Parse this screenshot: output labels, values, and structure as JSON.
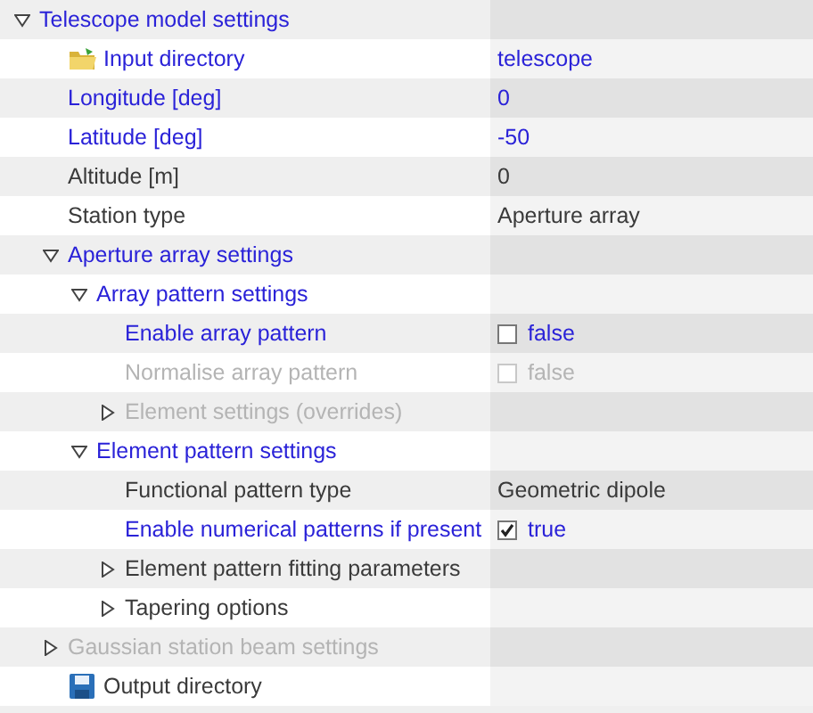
{
  "tree": [
    {
      "label": "Telescope model settings",
      "modified": true,
      "disabled": false,
      "expanded": true,
      "children": [
        {
          "label": "Input directory",
          "kind": "folder",
          "value": "telescope",
          "modified": true,
          "disabled": false
        },
        {
          "label": "Longitude [deg]",
          "value": "0",
          "modified": true,
          "disabled": false
        },
        {
          "label": "Latitude [deg]",
          "value": "-50",
          "modified": true,
          "disabled": false
        },
        {
          "label": "Altitude [m]",
          "value": "0",
          "modified": false,
          "disabled": false
        },
        {
          "label": "Station type",
          "value": "Aperture array",
          "modified": false,
          "disabled": false
        },
        {
          "label": "Aperture array settings",
          "modified": true,
          "disabled": false,
          "expanded": true,
          "children": [
            {
              "label": "Array pattern settings",
              "modified": true,
              "disabled": false,
              "expanded": true,
              "children": [
                {
                  "label": "Enable array pattern",
                  "value": "false",
                  "checked": false,
                  "modified": true,
                  "disabled": false
                },
                {
                  "label": "Normalise array pattern",
                  "value": "false",
                  "checked": false,
                  "disabled": true
                },
                {
                  "label": "Element settings (overrides)",
                  "disabled": true,
                  "expanded": false
                }
              ]
            },
            {
              "label": "Element pattern settings",
              "modified": true,
              "disabled": false,
              "expanded": true,
              "children": [
                {
                  "label": "Functional pattern type",
                  "value": "Geometric dipole",
                  "modified": false,
                  "disabled": false
                },
                {
                  "label": "Enable numerical patterns if present",
                  "value": "true",
                  "checked": true,
                  "modified": true,
                  "disabled": false
                },
                {
                  "label": "Element pattern fitting parameters",
                  "modified": false,
                  "disabled": false,
                  "expanded": false
                },
                {
                  "label": "Tapering options",
                  "modified": false,
                  "disabled": false,
                  "expanded": false
                }
              ]
            }
          ]
        },
        {
          "label": "Gaussian station beam settings",
          "disabled": true,
          "expanded": false
        },
        {
          "label": "Output directory",
          "kind": "save",
          "modified": false,
          "disabled": false
        }
      ]
    }
  ]
}
